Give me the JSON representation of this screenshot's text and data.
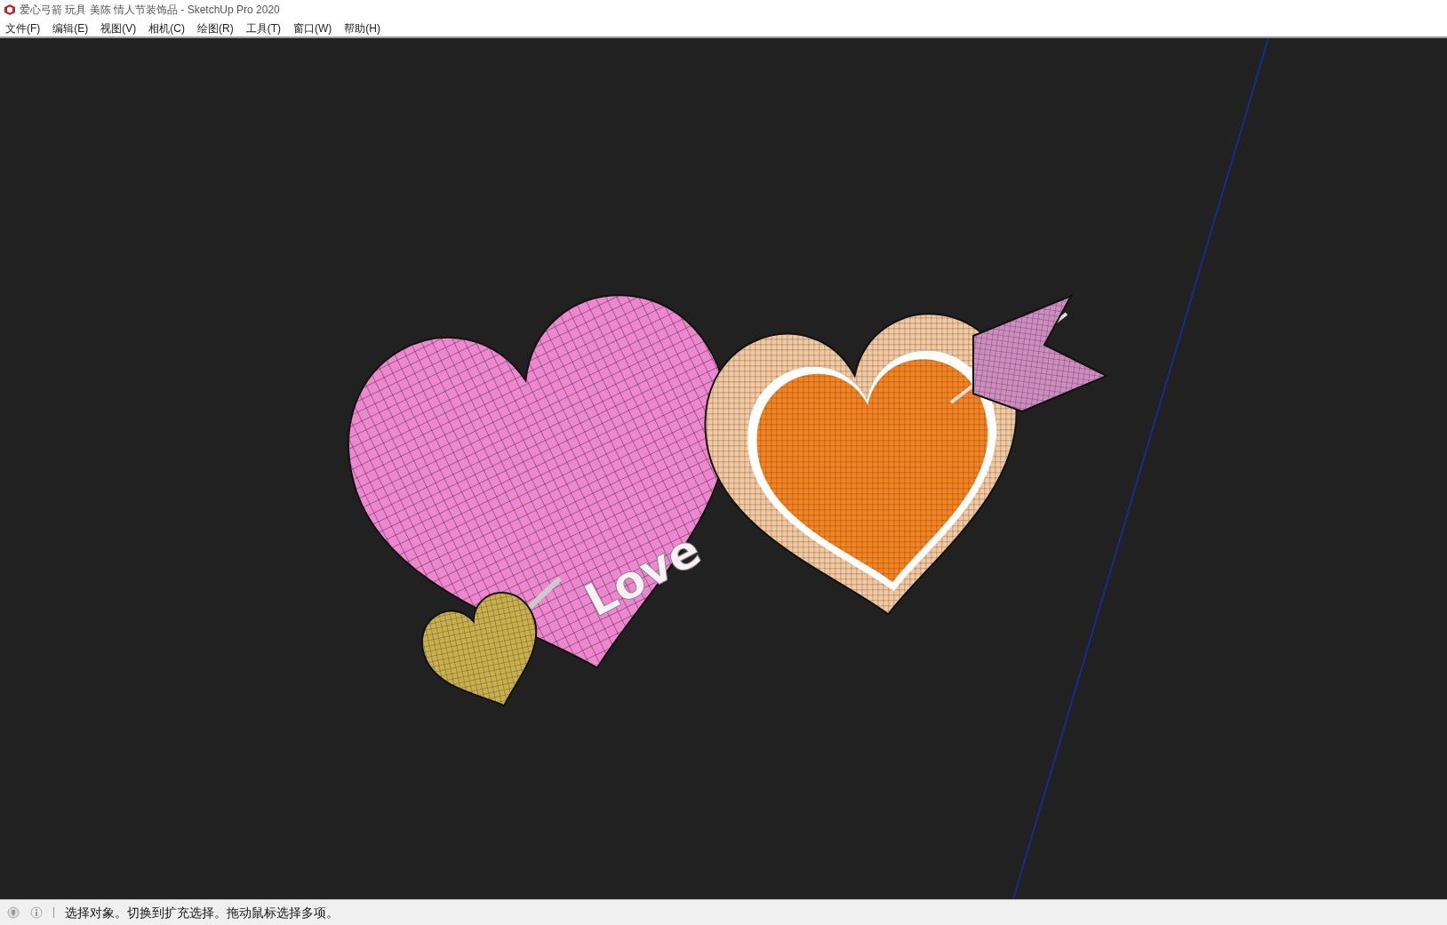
{
  "window": {
    "title": "爱心弓箭 玩具 美陈 情人节装饰品 - SketchUp Pro 2020"
  },
  "menu": [
    {
      "label": "文件(F)"
    },
    {
      "label": "编辑(E)"
    },
    {
      "label": "视图(V)"
    },
    {
      "label": "相机(C)"
    },
    {
      "label": "绘图(R)"
    },
    {
      "label": "工具(T)"
    },
    {
      "label": "窗口(W)"
    },
    {
      "label": "帮助(H)"
    }
  ],
  "model": {
    "text": "Love"
  },
  "status_bar": {
    "message": "选择对象。切换到扩充选择。拖动鼠标选择多项。"
  }
}
